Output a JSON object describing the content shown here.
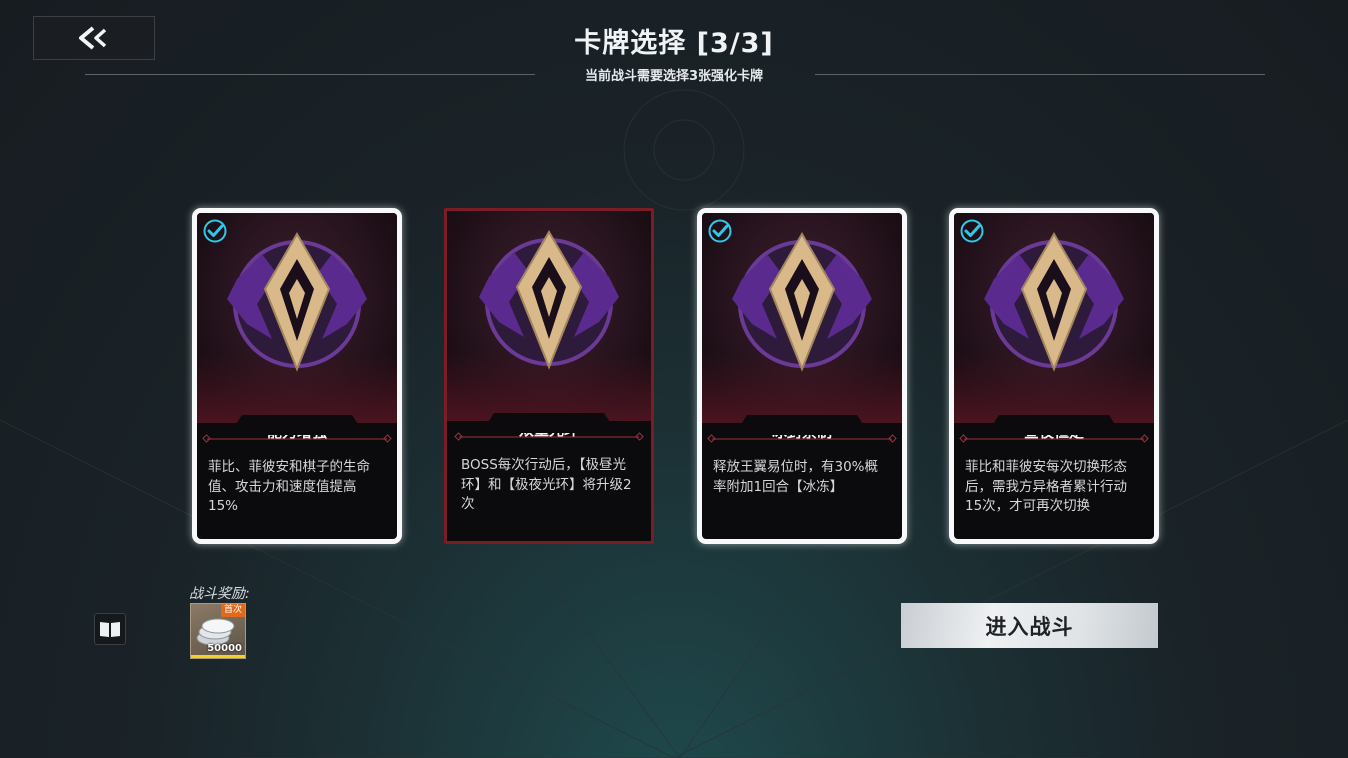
{
  "header": {
    "title": "卡牌选择 [3/3]",
    "subtitle": "当前战斗需要选择3张强化卡牌"
  },
  "cards": [
    {
      "name": "能力增强",
      "desc": "菲比、菲彼安和棋子的生命值、攻击力和速度值提高15%",
      "selected": true
    },
    {
      "name": "双重光环",
      "desc": "BOSS每次行动后，【极昼光环】和【极夜光环】将升级2次",
      "selected": false
    },
    {
      "name": "冰封禁制",
      "desc": "释放王翼易位时，有30%概率附加1回合【冰冻】",
      "selected": true
    },
    {
      "name": "昼夜恒定",
      "desc": "菲比和菲彼安每次切换形态后，需我方异格者累计行动15次，才可再次切换",
      "selected": true
    }
  ],
  "reward": {
    "label": "战斗奖励:",
    "badge": "首次",
    "count": "50000"
  },
  "enter_button": "进入战斗",
  "icons": {
    "back": "back-arrow-icon",
    "book": "book-icon",
    "check": "check-circle-icon",
    "reward": "silver-coins-icon"
  },
  "colors": {
    "selected_border": "#f7f9fb",
    "unselected_border": "#7a1d25",
    "check": "#2fc8e8",
    "emblem_purple": "#5a2a8e",
    "emblem_gold": "#d9b98a",
    "badge": "#e0691c"
  }
}
